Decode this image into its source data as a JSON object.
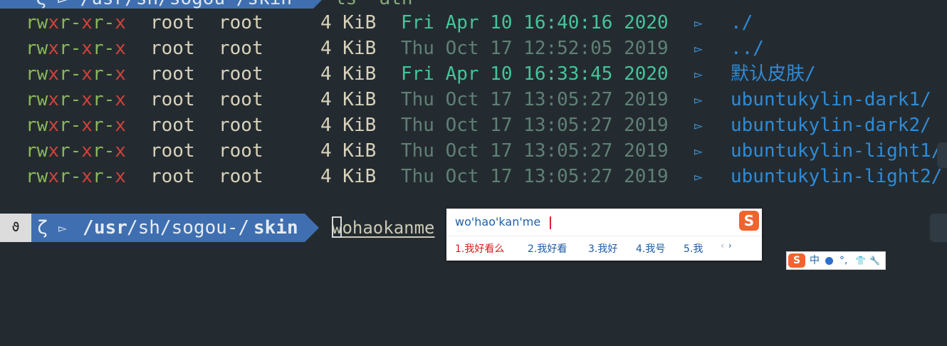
{
  "top_prompt": {
    "path_text": "ζ ▻ /usr/sh/sogou-/skin",
    "command_text": "ls -ath"
  },
  "listing": [
    {
      "perm": "rwxr-xr-x",
      "owner": "root",
      "group": "root",
      "size": "4 KiB",
      "date": "Fri Apr 10 16:40:16 2020",
      "recent": true,
      "icon": "▻",
      "name": "./"
    },
    {
      "perm": "rwxr-xr-x",
      "owner": "root",
      "group": "root",
      "size": "4 KiB",
      "date": "Thu Oct 17 12:52:05 2019",
      "recent": false,
      "icon": "▻",
      "name": "../"
    },
    {
      "perm": "rwxr-xr-x",
      "owner": "root",
      "group": "root",
      "size": "4 KiB",
      "date": "Fri Apr 10 16:33:45 2020",
      "recent": true,
      "icon": "▻",
      "name": "默认皮肤/"
    },
    {
      "perm": "rwxr-xr-x",
      "owner": "root",
      "group": "root",
      "size": "4 KiB",
      "date": "Thu Oct 17 13:05:27 2019",
      "recent": false,
      "icon": "▻",
      "name": "ubuntukylin-dark1/"
    },
    {
      "perm": "rwxr-xr-x",
      "owner": "root",
      "group": "root",
      "size": "4 KiB",
      "date": "Thu Oct 17 13:05:27 2019",
      "recent": false,
      "icon": "▻",
      "name": "ubuntukylin-dark2/"
    },
    {
      "perm": "rwxr-xr-x",
      "owner": "root",
      "group": "root",
      "size": "4 KiB",
      "date": "Thu Oct 17 13:05:27 2019",
      "recent": false,
      "icon": "▻",
      "name": "ubuntukylin-light1/"
    },
    {
      "perm": "rwxr-xr-x",
      "owner": "root",
      "group": "root",
      "size": "4 KiB",
      "date": "Thu Oct 17 13:05:27 2019",
      "recent": false,
      "icon": "▻",
      "name": "ubuntukylin-light2/"
    }
  ],
  "prompt": {
    "badge": "ϑ",
    "zeta": "ζ",
    "arrow_glyph": "▻",
    "path_prefix": "/",
    "path_usr": "usr",
    "path_mid": "/sh/sogou-/",
    "path_skin": "skin",
    "input_text": "wohaokanme"
  },
  "ime": {
    "pinyin": "wo'hao'kan'me",
    "logo": "S",
    "candidates": [
      "1.我好看么",
      "2.我好看",
      "3.我好",
      "4.我号",
      "5.我"
    ],
    "pager_prev": "‹",
    "pager_next": "›"
  },
  "ime_bar": {
    "logo": "S",
    "mode": "中",
    "punct": "°,",
    "skin": "👕",
    "tool": "🔧"
  },
  "colors": {
    "background": "#242b30",
    "prompt_blue": "#3f6fb0",
    "dir_blue": "#2f8bd6",
    "recent_date": "#45c49a",
    "old_date": "#5f8075",
    "perm_green": "#89b75a",
    "perm_red": "#d0423a",
    "sogou_orange": "#f0642e"
  }
}
